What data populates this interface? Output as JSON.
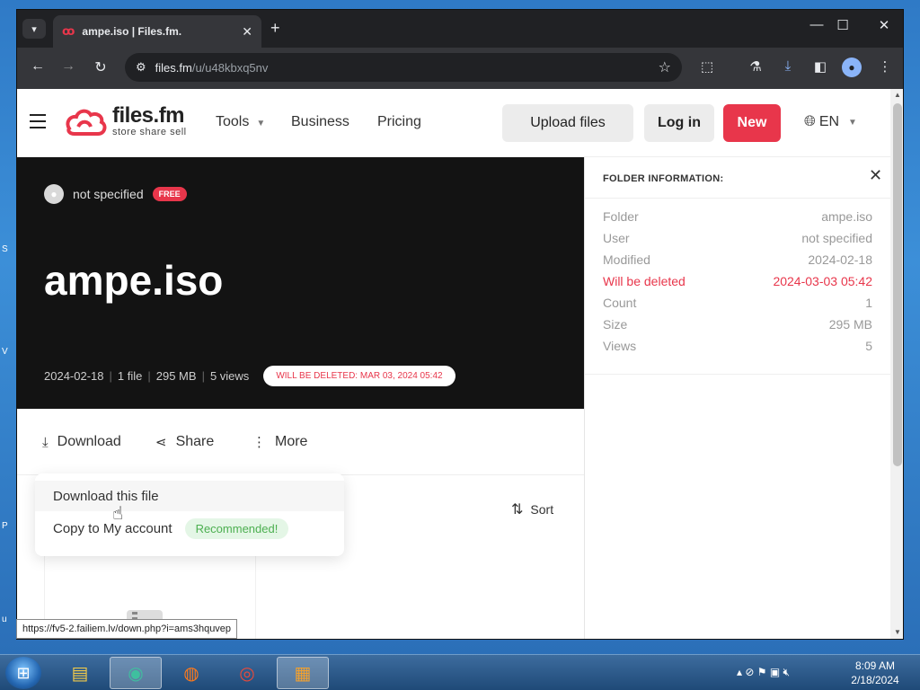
{
  "browser": {
    "tab_title": "ampe.iso | Files.fm.",
    "url_host": "files.fm",
    "url_path": "/u/u48kbxq5nv",
    "status_url": "https://fv5-2.failiem.lv/down.php?i=ams3hquvep"
  },
  "site": {
    "logo_name": "files.fm",
    "logo_tagline": "store share sell",
    "nav": {
      "tools": "Tools",
      "business": "Business",
      "pricing": "Pricing"
    },
    "upload_label": "Upload files",
    "login_label": "Log in",
    "new_label": "New",
    "lang_label": "EN"
  },
  "hero": {
    "owner_name": "not specified",
    "badge": "FREE",
    "title": "ampe.iso",
    "meta_date": "2024-02-18",
    "meta_files": "1 file",
    "meta_size": "295 MB",
    "meta_views": "5 views",
    "delete_pill": "WILL BE DELETED: MAR 03, 2024 05:42"
  },
  "actions": {
    "download": "Download",
    "share": "Share",
    "more": "More",
    "sort": "Sort"
  },
  "menu": {
    "download_file": "Download this file",
    "copy_account": "Copy to My account",
    "recommended": "Recommended!"
  },
  "info_panel": {
    "title": "FOLDER INFORMATION:",
    "rows": [
      {
        "key": "Folder",
        "value": "ampe.iso"
      },
      {
        "key": "User",
        "value": "not specified"
      },
      {
        "key": "Modified",
        "value": "2024-02-18"
      },
      {
        "key": "Will be deleted",
        "value": "2024-03-03 05:42"
      },
      {
        "key": "Count",
        "value": "1"
      },
      {
        "key": "Size",
        "value": "295 MB"
      },
      {
        "key": "Views",
        "value": "5"
      }
    ]
  },
  "taskbar": {
    "time": "8:09 AM",
    "date": "2/18/2024"
  },
  "colors": {
    "brand_red": "#e8364b",
    "hero_bg": "#131313",
    "recommended_green": "#4caf50"
  }
}
